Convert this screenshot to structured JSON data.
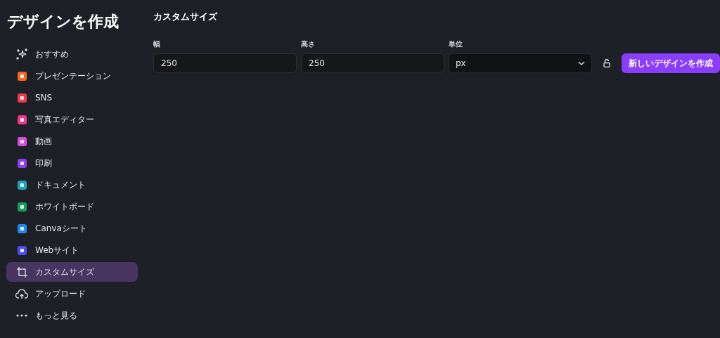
{
  "sidebar": {
    "title": "デザインを作成",
    "items": [
      {
        "label": "おすすめ",
        "kind": "sparkle",
        "selected": false
      },
      {
        "label": "プレゼンテーション",
        "kind": "tile",
        "color": "#f26a1b",
        "selected": false
      },
      {
        "label": "SNS",
        "kind": "tile",
        "color": "#f0384f",
        "selected": false
      },
      {
        "label": "写真エディター",
        "kind": "tile",
        "color": "#f0368f",
        "selected": false
      },
      {
        "label": "動画",
        "kind": "tile",
        "color": "#d84ee0",
        "selected": false
      },
      {
        "label": "印刷",
        "kind": "tile",
        "color": "#8b3ff0",
        "selected": false
      },
      {
        "label": "ドキュメント",
        "kind": "tile",
        "color": "#1fa3b8",
        "selected": false
      },
      {
        "label": "ホワイトボード",
        "kind": "tile",
        "color": "#18a05a",
        "selected": false
      },
      {
        "label": "Canvaシート",
        "kind": "tile",
        "color": "#1f8bf0",
        "selected": false
      },
      {
        "label": "Webサイト",
        "kind": "tile",
        "color": "#4c4cf0",
        "selected": false
      },
      {
        "label": "カスタムサイズ",
        "kind": "crop",
        "selected": true
      },
      {
        "label": "アップロード",
        "kind": "upload",
        "selected": false
      },
      {
        "label": "もっと見る",
        "kind": "more",
        "selected": false
      }
    ]
  },
  "main": {
    "heading": "カスタムサイズ",
    "width": {
      "label": "幅",
      "value": "250"
    },
    "height": {
      "label": "高さ",
      "value": "250"
    },
    "unit": {
      "label": "単位",
      "value": "px"
    },
    "locked": false,
    "create_button": "新しいデザインを作成"
  }
}
